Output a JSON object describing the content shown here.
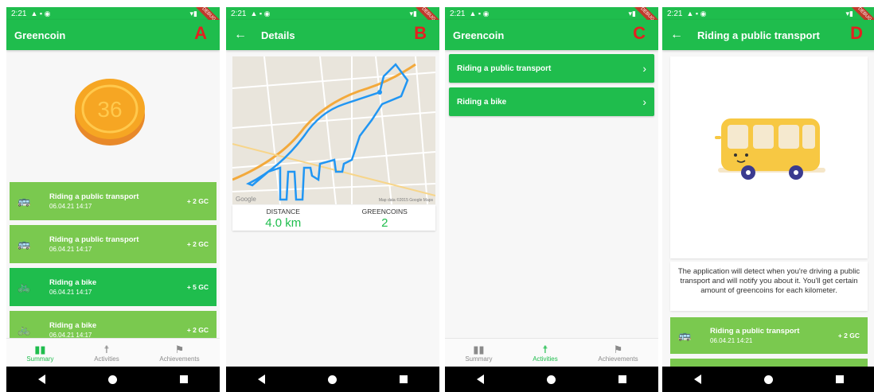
{
  "status": {
    "time": "2:21",
    "debug": "DEBUG"
  },
  "panels": {
    "A": {
      "letter": "A",
      "title": "Greencoin",
      "coin_value": "36",
      "history": [
        {
          "name": "Riding a public transport",
          "date": "06.04.21 14:17",
          "points": "+ 2 GC",
          "icon": "bus-icon"
        },
        {
          "name": "Riding a public transport",
          "date": "06.04.21 14:17",
          "points": "+ 2 GC",
          "icon": "bus-icon"
        },
        {
          "name": "Riding a bike",
          "date": "06.04.21 14:17",
          "points": "+ 5 GC",
          "icon": "bike-icon"
        },
        {
          "name": "Riding a bike",
          "date": "06.04.21 14:17",
          "points": "+ 2 GC",
          "icon": "bike-icon"
        }
      ]
    },
    "B": {
      "letter": "B",
      "title": "Details",
      "map_attribution": "Map data ©2015 Google Maps",
      "map_logo": "Google",
      "distance_label": "DISTANCE",
      "distance_value": "4.0 km",
      "greencoins_label": "GREENCOINS",
      "greencoins_value": "2"
    },
    "C": {
      "letter": "C",
      "title": "Greencoin",
      "activities": [
        {
          "name": "Riding a public transport"
        },
        {
          "name": "Riding a bike"
        }
      ]
    },
    "D": {
      "letter": "D",
      "title": "Riding a public transport",
      "description": "The application will detect when you're driving a public transport and will notify you about it. You'll get certain amount of greencoins for each kilometer.",
      "entry": {
        "name": "Riding a public transport",
        "date": "06.04.21 14:21",
        "points": "+ 2 GC"
      }
    }
  },
  "bottom_nav": {
    "summary": "Summary",
    "activities": "Activities",
    "achievements": "Achievements"
  },
  "colors": {
    "primary": "#1fbd4d",
    "secondary": "#7ac94f",
    "coin": "#f6a623",
    "label": "#e32020"
  }
}
